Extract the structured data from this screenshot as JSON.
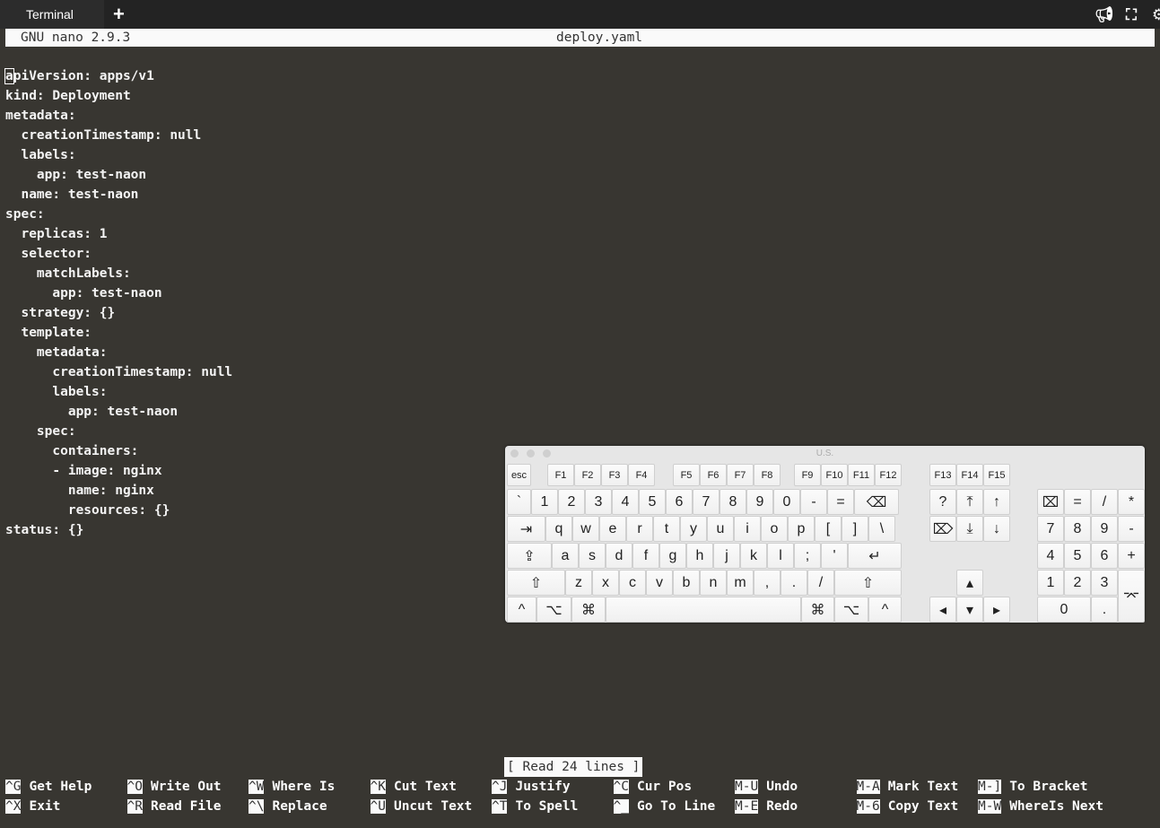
{
  "tabbar": {
    "tab_label": "Terminal",
    "new_tab": "+",
    "icons": [
      "megaphone-icon",
      "fullscreen-icon",
      "gear-icon"
    ]
  },
  "nano": {
    "version": "GNU nano 2.9.3",
    "filename": "deploy.yaml"
  },
  "editor_lines": [
    "apiVersion: apps/v1",
    "kind: Deployment",
    "metadata:",
    "  creationTimestamp: null",
    "  labels:",
    "    app: test-naon",
    "  name: test-naon",
    "spec:",
    "  replicas: 1",
    "  selector:",
    "    matchLabels:",
    "      app: test-naon",
    "  strategy: {}",
    "  template:",
    "    metadata:",
    "      creationTimestamp: null",
    "      labels:",
    "        app: test-naon",
    "    spec:",
    "      containers:",
    "      - image: nginx",
    "        name: nginx",
    "        resources: {}",
    "status: {}"
  ],
  "status_message": "[ Read 24 lines ]",
  "shortcuts": [
    [
      {
        "key": "^G",
        "label": "Get Help"
      },
      {
        "key": "^X",
        "label": "Exit"
      }
    ],
    [
      {
        "key": "^O",
        "label": "Write Out"
      },
      {
        "key": "^R",
        "label": "Read File"
      }
    ],
    [
      {
        "key": "^W",
        "label": "Where Is"
      },
      {
        "key": "^\\",
        "label": "Replace"
      }
    ],
    [
      {
        "key": "^K",
        "label": "Cut Text"
      },
      {
        "key": "^U",
        "label": "Uncut Text"
      }
    ],
    [
      {
        "key": "^J",
        "label": "Justify"
      },
      {
        "key": "^T",
        "label": "To Spell"
      }
    ],
    [
      {
        "key": "^C",
        "label": "Cur Pos"
      },
      {
        "key": "^_",
        "label": "Go To Line"
      }
    ],
    [
      {
        "key": "M-U",
        "label": "Undo"
      },
      {
        "key": "M-E",
        "label": "Redo"
      }
    ],
    [
      {
        "key": "M-A",
        "label": "Mark Text"
      },
      {
        "key": "M-6",
        "label": "Copy Text"
      }
    ],
    [
      {
        "key": "M-]",
        "label": "To Bracket"
      },
      {
        "key": "M-W",
        "label": "WhereIs Next"
      }
    ]
  ],
  "keyboard": {
    "title": "U.S.",
    "rows": [
      [
        "esc",
        "F1",
        "F2",
        "F3",
        "F4",
        "F5",
        "F6",
        "F7",
        "F8",
        "F9",
        "F10",
        "F11",
        "F12",
        "F13",
        "F14",
        "F15"
      ],
      [
        "`",
        "1",
        "2",
        "3",
        "4",
        "5",
        "6",
        "7",
        "8",
        "9",
        "0",
        "-",
        "=",
        "⌫",
        "?",
        "⤒",
        "↑",
        "⌧",
        "=",
        "/",
        "*"
      ],
      [
        "⇥",
        "q",
        "w",
        "e",
        "r",
        "t",
        "y",
        "u",
        "i",
        "o",
        "p",
        "[",
        "]",
        "\\",
        "⌦",
        "⤓",
        "↓",
        "7",
        "8",
        "9",
        "-"
      ],
      [
        "⇪",
        "a",
        "s",
        "d",
        "f",
        "g",
        "h",
        "j",
        "k",
        "l",
        ";",
        "'",
        "↵",
        "4",
        "5",
        "6",
        "+"
      ],
      [
        "⇧",
        "z",
        "x",
        "c",
        "v",
        "b",
        "n",
        "m",
        ",",
        ".",
        "/",
        "⇧",
        "▴",
        "1",
        "2",
        "3",
        "⌤"
      ],
      [
        "^",
        "⌥",
        "⌘",
        "",
        "⌘",
        "⌥",
        "^",
        "◂",
        "▾",
        "▸",
        "0",
        "."
      ]
    ]
  }
}
